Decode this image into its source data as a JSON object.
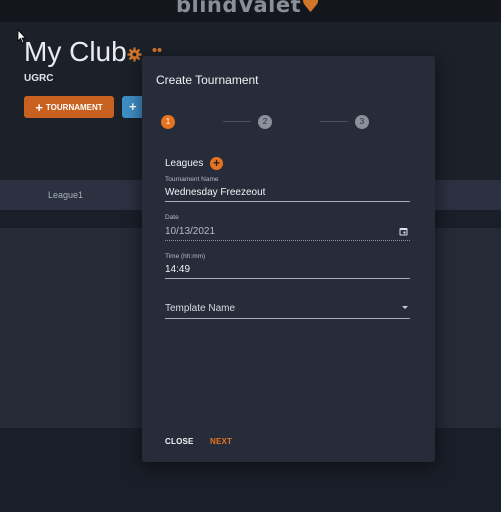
{
  "app": {
    "logo_main": "blindValet",
    "logo_accent": "♥"
  },
  "club": {
    "title": "My Club",
    "subtitle": "UGRC"
  },
  "toolbar": {
    "tournament_label": "TOURNAMENT",
    "plus": "+",
    "second_plus": "+"
  },
  "league_row": {
    "name": "League1"
  },
  "modal": {
    "title": "Create Tournament",
    "steps": [
      "1",
      "2",
      "3"
    ],
    "leagues_label": "Leagues",
    "add_label": "+",
    "tournament_name": {
      "label": "Tournament Name",
      "value": "Wednesday Freezeout"
    },
    "date": {
      "label": "Date",
      "value": "10/13/2021"
    },
    "time": {
      "label": "Time (hh:mm)",
      "value": "14:49"
    },
    "template": {
      "placeholder": "Template Name"
    },
    "close_label": "CLOSE",
    "next_label": "NEXT"
  },
  "colors": {
    "accent": "#e8731f",
    "button_orange": "#c8611f",
    "button_blue": "#3e8fc7",
    "modal_bg": "#272c3a",
    "page_bg": "#1a1e28"
  },
  "icons": [
    "gear-icon",
    "more-dots-icon",
    "calendar-icon",
    "chevron-down-icon",
    "plus-icon",
    "cursor-icon"
  ]
}
